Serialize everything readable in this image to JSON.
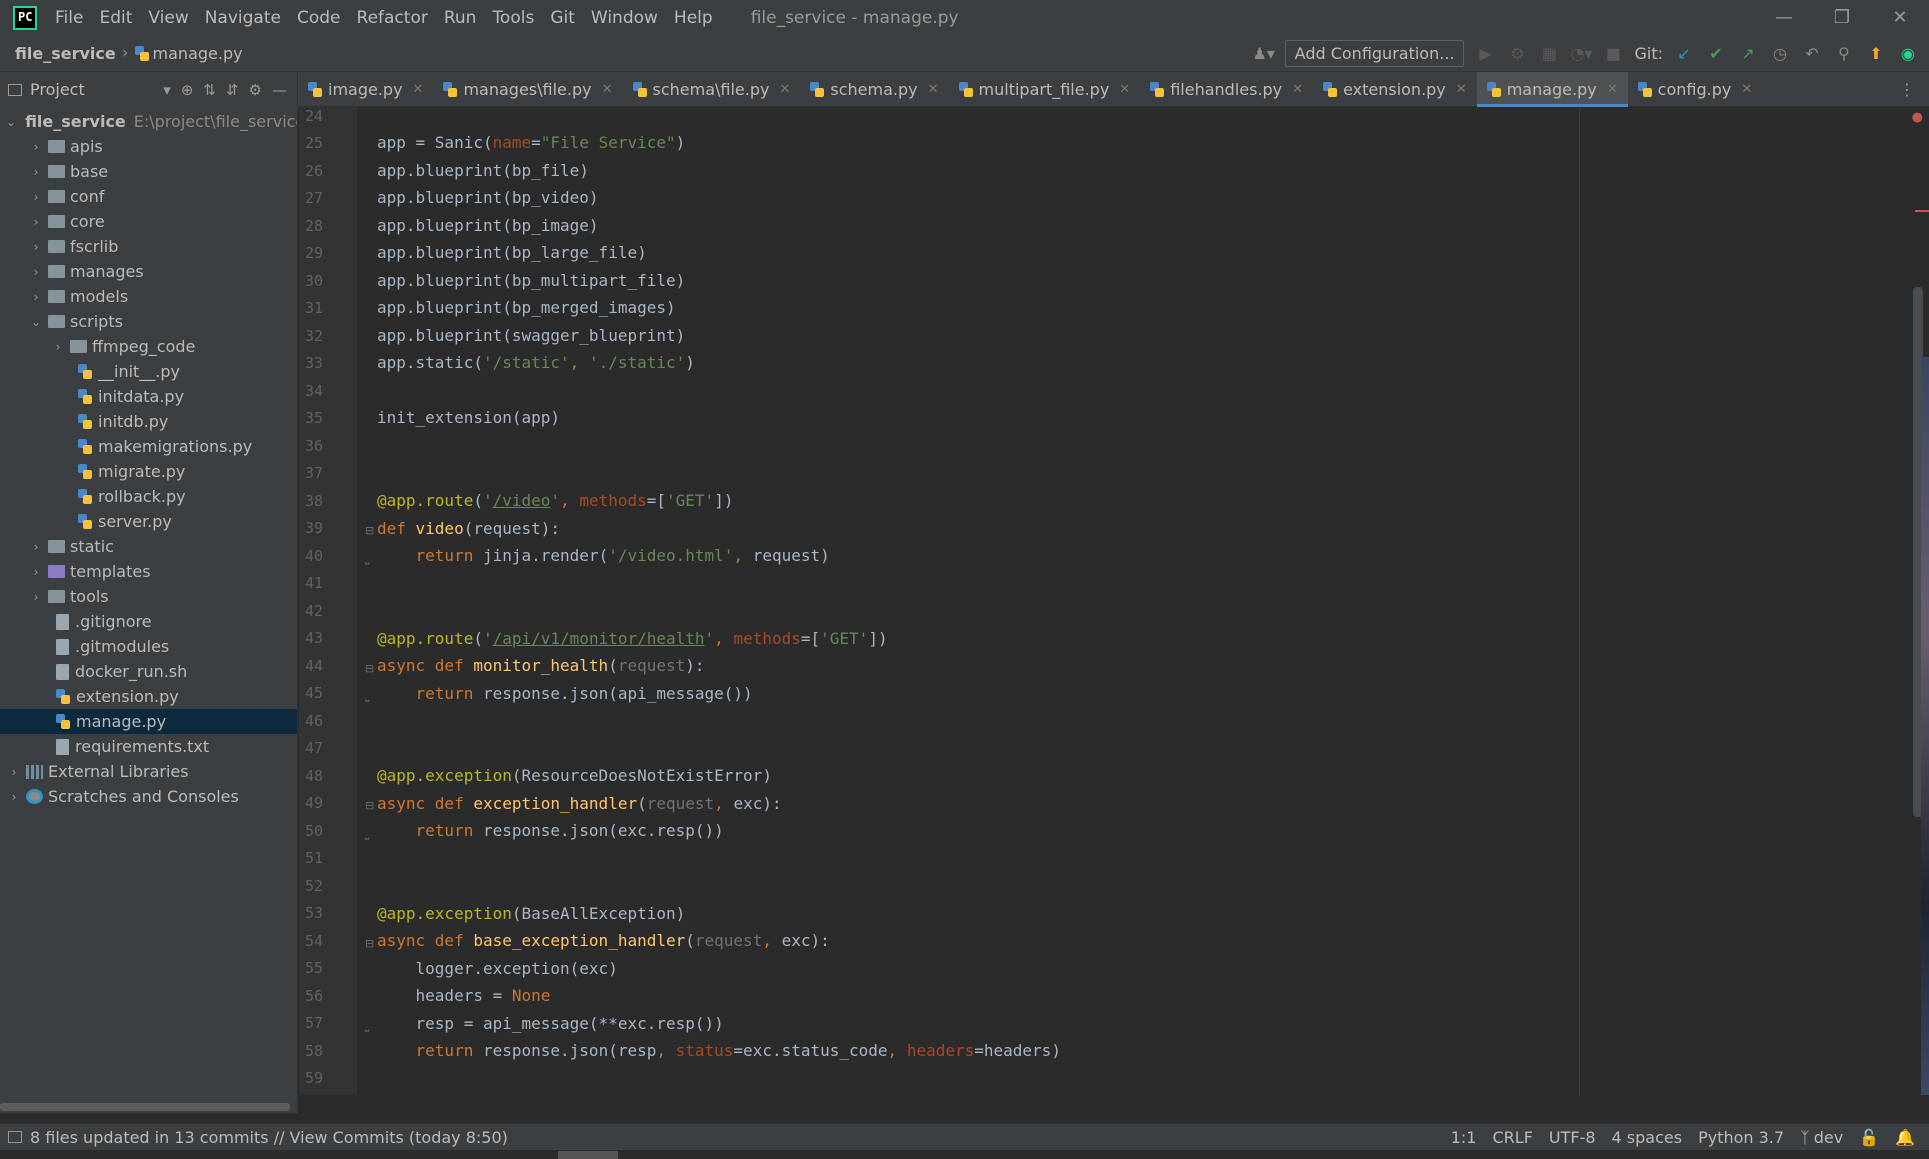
{
  "menu": [
    "File",
    "Edit",
    "View",
    "Navigate",
    "Code",
    "Refactor",
    "Run",
    "Tools",
    "Git",
    "Window",
    "Help"
  ],
  "window_title": "file_service - manage.py",
  "breadcrumb": {
    "root": "file_service",
    "file": "manage.py"
  },
  "toolbar": {
    "add_config": "Add Configuration...",
    "git_label": "Git:"
  },
  "project_panel": {
    "title": "Project"
  },
  "tabs": [
    {
      "label": "image.py",
      "active": false
    },
    {
      "label": "manages\\file.py",
      "active": false
    },
    {
      "label": "schema\\file.py",
      "active": false
    },
    {
      "label": "schema.py",
      "active": false
    },
    {
      "label": "multipart_file.py",
      "active": false
    },
    {
      "label": "filehandles.py",
      "active": false
    },
    {
      "label": "extension.py",
      "active": false
    },
    {
      "label": "manage.py",
      "active": true
    },
    {
      "label": "config.py",
      "active": false
    }
  ],
  "tree": {
    "root": "file_service",
    "root_path": "E:\\project\\file_service",
    "items": [
      "apis",
      "base",
      "conf",
      "core",
      "fscrlib",
      "manages",
      "models",
      "scripts",
      "ffmpeg_code",
      "__init__.py",
      "initdata.py",
      "initdb.py",
      "makemigrations.py",
      "migrate.py",
      "rollback.py",
      "server.py",
      "static",
      "templates",
      "tools",
      ".gitignore",
      ".gitmodules",
      "docker_run.sh",
      "extension.py",
      "manage.py",
      "requirements.txt",
      "External Libraries",
      "Scratches and Consoles"
    ]
  },
  "line_numbers": [
    "24",
    "25",
    "26",
    "27",
    "28",
    "29",
    "30",
    "31",
    "32",
    "33",
    "34",
    "35",
    "36",
    "37",
    "38",
    "39",
    "40",
    "41",
    "42",
    "43",
    "44",
    "45",
    "46",
    "47",
    "48",
    "49",
    "50",
    "51",
    "52",
    "53",
    "54",
    "55",
    "56",
    "57",
    "58",
    "59"
  ],
  "code": {
    "l25_a": "app = Sanic(",
    "l25_b": "name",
    "l25_c": "=",
    "l25_d": "\"File Service\"",
    "l25_e": ")",
    "l26": "app.blueprint(bp_file)",
    "l27": "app.blueprint(bp_video)",
    "l28": "app.blueprint(bp_image)",
    "l29": "app.blueprint(bp_large_file)",
    "l30": "app.blueprint(bp_multipart_file)",
    "l31": "app.blueprint(bp_merged_images)",
    "l32": "app.blueprint(swagger_blueprint)",
    "l33_a": "app.static(",
    "l33_b": "'/static'",
    "l33_c": ", ",
    "l33_d": "'./static'",
    "l33_e": ")",
    "l35": "init_extension(app)",
    "l38_a": "@app.route",
    "l38_b": "(",
    "l38_c": "'",
    "l38_d": "/video",
    "l38_e": "'",
    "l38_f": ", ",
    "l38_g": "methods",
    "l38_h": "=[",
    "l38_i": "'GET'",
    "l38_j": "])",
    "l39_a": "def ",
    "l39_b": "video",
    "l39_c": "(request):",
    "l40_a": "    return ",
    "l40_b": "jinja.render(",
    "l40_c": "'/video.html'",
    "l40_d": ", ",
    "l40_e": "request)",
    "l43_a": "@app.route",
    "l43_b": "(",
    "l43_c": "'",
    "l43_d": "/api/v1/monitor/health",
    "l43_e": "'",
    "l43_f": ", ",
    "l43_g": "methods",
    "l43_h": "=[",
    "l43_i": "'GET'",
    "l43_j": "])",
    "l44_a": "async def ",
    "l44_b": "monitor_health",
    "l44_c": "(",
    "l44_d": "request",
    "l44_e": "):",
    "l45_a": "    return ",
    "l45_b": "response.json(api_message())",
    "l48_a": "@app.exception",
    "l48_b": "(ResourceDoesNotExistError)",
    "l49_a": "async def ",
    "l49_b": "exception_handler",
    "l49_c": "(",
    "l49_d": "request",
    "l49_e": ", ",
    "l49_f": "exc):",
    "l50_a": "    return ",
    "l50_b": "response.json(exc.resp())",
    "l53_a": "@app.exception",
    "l53_b": "(BaseAllException)",
    "l54_a": "async def ",
    "l54_b": "base_exception_handler",
    "l54_c": "(",
    "l54_d": "request",
    "l54_e": ", ",
    "l54_f": "exc):",
    "l55": "    logger.exception(exc)",
    "l56_a": "    headers = ",
    "l56_b": "None",
    "l57": "    resp = api_message(**exc.resp())",
    "l58_a": "    return ",
    "l58_b": "response.json(resp",
    "l58_c": ", ",
    "l58_d": "status",
    "l58_e": "=exc.status_code",
    "l58_f": ", ",
    "l58_g": "headers",
    "l58_h": "=headers)"
  },
  "status": {
    "message": "8 files updated in 13 commits // View Commits (today 8:50)",
    "position": "1:1",
    "line_sep": "CRLF",
    "encoding": "UTF-8",
    "indent": "4 spaces",
    "interpreter": "Python 3.7",
    "branch": "dev"
  },
  "colors": {
    "accent": "#4a88c7",
    "keyword": "#cc7832",
    "string": "#6a8759",
    "decorator": "#bbb529",
    "function": "#ffc66d"
  }
}
